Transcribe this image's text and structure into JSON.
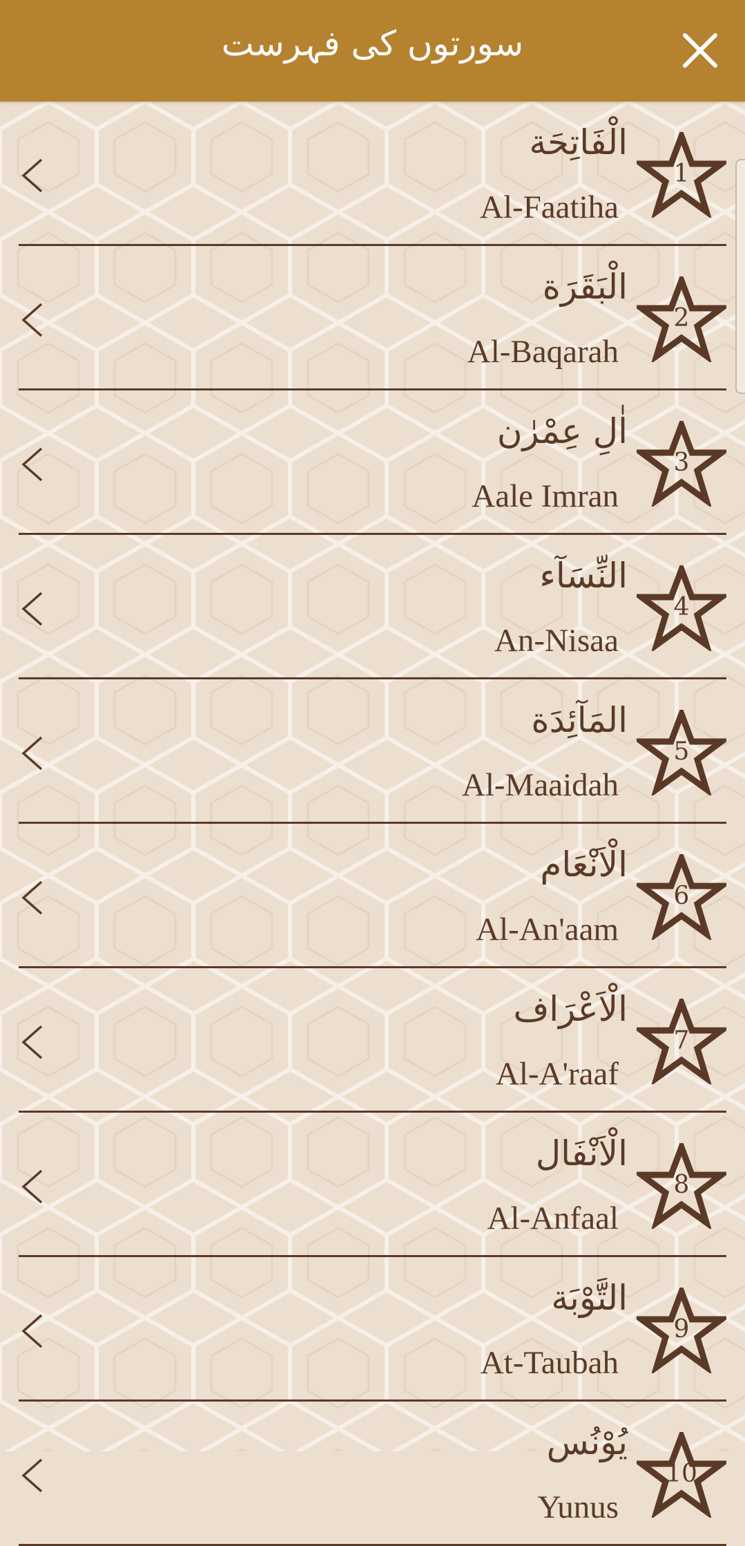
{
  "header": {
    "title": "سورتوں کی فہرست",
    "close_icon": "close-icon"
  },
  "colors": {
    "header_bg": "#b58230",
    "page_bg": "#ecdfd0",
    "text": "#5a3a26"
  },
  "surahs": [
    {
      "number": "1",
      "arabic": "الْفَاتِحَة",
      "english": "Al-Faatiha"
    },
    {
      "number": "2",
      "arabic": "الْبَقَرَة",
      "english": "Al-Baqarah"
    },
    {
      "number": "3",
      "arabic": "اٰلِ عِمْرٰن",
      "english": "Aale Imran"
    },
    {
      "number": "4",
      "arabic": "النِّسَآء",
      "english": "An-Nisaa"
    },
    {
      "number": "5",
      "arabic": "المَآئِدَة",
      "english": "Al-Maaidah"
    },
    {
      "number": "6",
      "arabic": "الْاَنْعَام",
      "english": "Al-An'aam"
    },
    {
      "number": "7",
      "arabic": "الْاَعْرَاف",
      "english": "Al-A'raaf"
    },
    {
      "number": "8",
      "arabic": "الْاَنْفَال",
      "english": "Al-Anfaal"
    },
    {
      "number": "9",
      "arabic": "التَّوْبَة",
      "english": "At-Taubah"
    },
    {
      "number": "10",
      "arabic": "يُوْنُس",
      "english": "Yunus"
    }
  ]
}
